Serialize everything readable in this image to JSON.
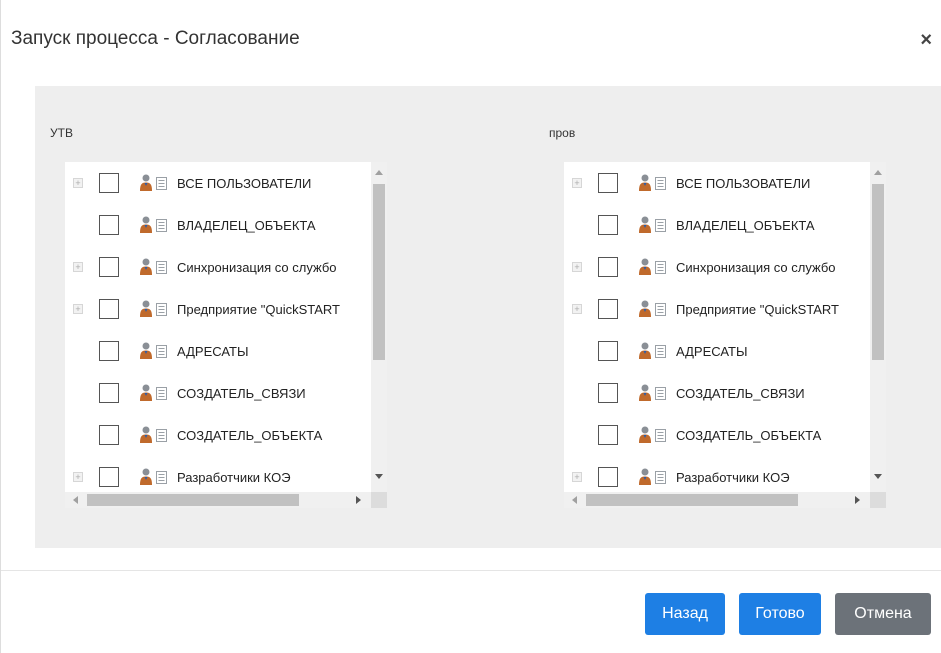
{
  "dialog": {
    "title": "Запуск процесса - Согласование",
    "close_symbol": "×"
  },
  "panels": {
    "left": {
      "label": "УТВ",
      "items": [
        {
          "label": "ВСЕ ПОЛЬЗОВАТЕЛИ",
          "expandable": true
        },
        {
          "label": "ВЛАДЕЛЕЦ_ОБЪЕКТА",
          "expandable": false
        },
        {
          "label": "Синхронизация со службо",
          "expandable": true
        },
        {
          "label": "Предприятие \"QuickSTART",
          "expandable": true
        },
        {
          "label": "АДРЕСАТЫ",
          "expandable": false
        },
        {
          "label": "СОЗДАТЕЛЬ_СВЯЗИ",
          "expandable": false
        },
        {
          "label": "СОЗДАТЕЛЬ_ОБЪЕКТА",
          "expandable": false
        },
        {
          "label": "Разработчики КОЭ",
          "expandable": true
        }
      ]
    },
    "right": {
      "label": "пров",
      "items": [
        {
          "label": "ВСЕ ПОЛЬЗОВАТЕЛИ",
          "expandable": true
        },
        {
          "label": "ВЛАДЕЛЕЦ_ОБЪЕКТА",
          "expandable": false
        },
        {
          "label": "Синхронизация со службо",
          "expandable": true
        },
        {
          "label": "Предприятие \"QuickSTART",
          "expandable": true
        },
        {
          "label": "АДРЕСАТЫ",
          "expandable": false
        },
        {
          "label": "СОЗДАТЕЛЬ_СВЯЗИ",
          "expandable": false
        },
        {
          "label": "СОЗДАТЕЛЬ_ОБЪЕКТА",
          "expandable": false
        },
        {
          "label": "Разработчики КОЭ",
          "expandable": true
        }
      ]
    }
  },
  "icons": {
    "item_icon": "user-group-icon",
    "list_icon": "list-icon",
    "expander": "+"
  },
  "footer": {
    "back_label": "Назад",
    "done_label": "Готово",
    "cancel_label": "Отмена"
  },
  "colors": {
    "primary": "#1e7fe4",
    "secondary": "#6c7279",
    "body_bg": "#eeeeee"
  }
}
